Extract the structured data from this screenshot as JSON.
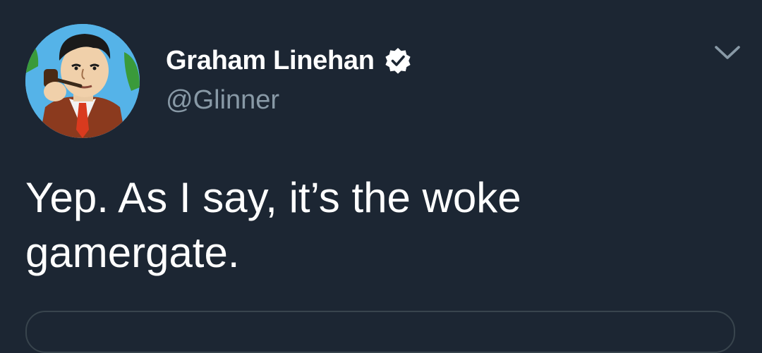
{
  "tweet": {
    "author": {
      "display_name": "Graham Linehan",
      "handle": "@Glinner",
      "verified_icon": "verified-badge-icon",
      "avatar": "cartoon-avatar"
    },
    "menu_icon": "chevron-down-icon",
    "text": "Yep. As I say, it’s the woke gamergate."
  },
  "colors": {
    "background": "#1c2633",
    "text_primary": "#ffffff",
    "text_secondary": "#8899a6",
    "card_border": "#38444d"
  }
}
